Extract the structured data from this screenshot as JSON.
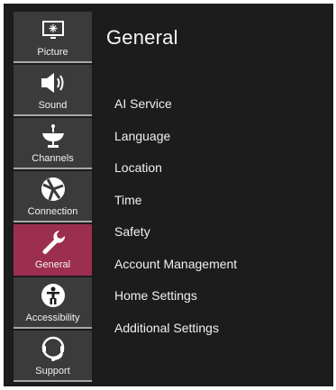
{
  "header": {
    "title": "General"
  },
  "sidebar": {
    "items": [
      {
        "label": "Picture",
        "icon": "picture-icon",
        "active": false
      },
      {
        "label": "Sound",
        "icon": "speaker-icon",
        "active": false
      },
      {
        "label": "Channels",
        "icon": "satellite-dish-icon",
        "active": false
      },
      {
        "label": "Connection",
        "icon": "network-globe-icon",
        "active": false
      },
      {
        "label": "General",
        "icon": "wrench-icon",
        "active": true
      },
      {
        "label": "Accessibility",
        "icon": "accessibility-icon",
        "active": false
      },
      {
        "label": "Support",
        "icon": "headset-support-icon",
        "active": false
      }
    ]
  },
  "menu": {
    "items": [
      "AI Service",
      "Language",
      "Location",
      "Time",
      "Safety",
      "Account Management",
      "Home Settings",
      "Additional Settings"
    ]
  },
  "colors": {
    "active": "#9c2e4f",
    "background": "#1c1c1c",
    "tile": "#3b3b3b"
  }
}
